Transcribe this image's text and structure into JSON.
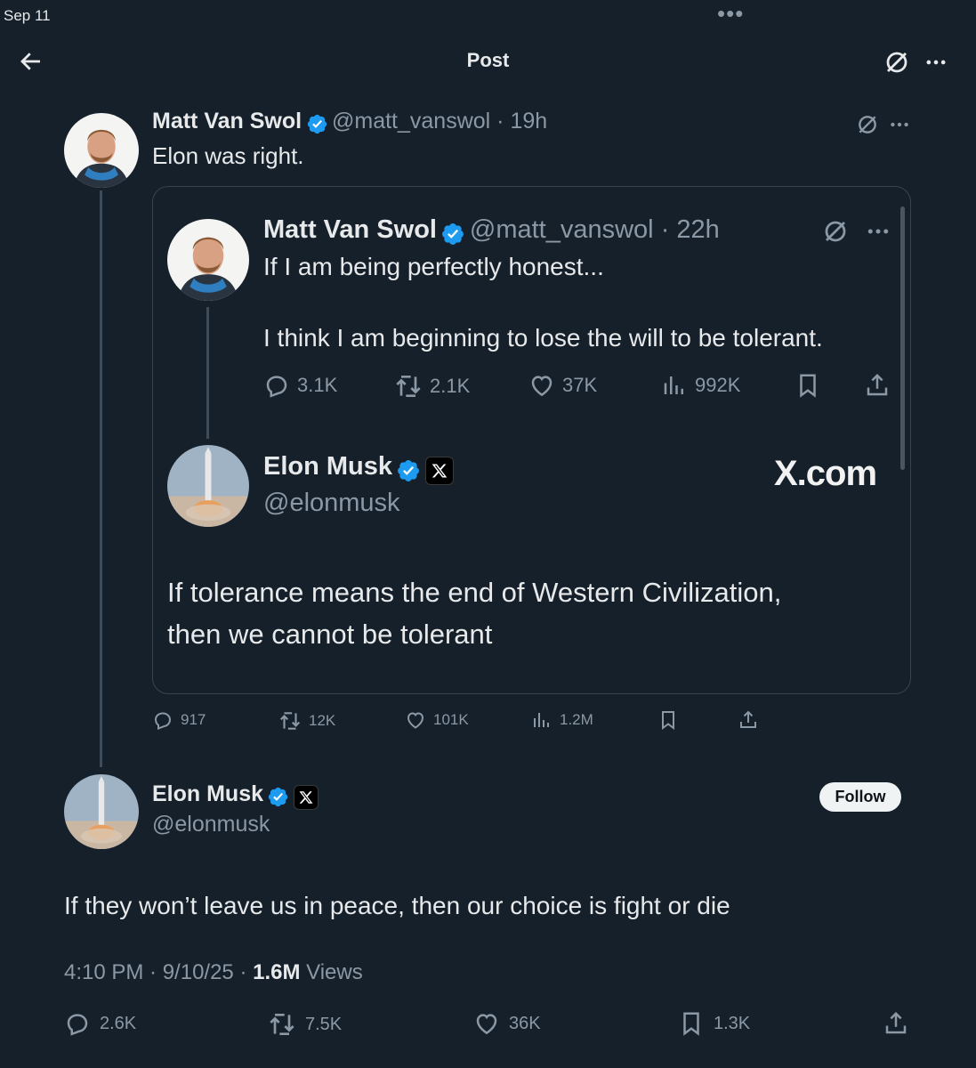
{
  "status": {
    "date": "Sep 11"
  },
  "header": {
    "title": "Post"
  },
  "main_post": {
    "name": "Matt Van Swol",
    "handle": "@matt_vanswol",
    "time": "19h",
    "text": "Elon was right.",
    "quote": {
      "tweet": {
        "name": "Matt Van Swol",
        "handle": "@matt_vanswol",
        "time": "22h",
        "line1": "If I am being perfectly honest...",
        "line2": "I think I am beginning to lose the will to be tolerant.",
        "replies": "3.1K",
        "reposts": "2.1K",
        "likes": "37K",
        "views": "992K"
      },
      "reply": {
        "name": "Elon Musk",
        "handle": "@elonmusk",
        "watermark": "X.com",
        "line1": "If tolerance means the end of Western Civilization,",
        "line2": "then we cannot be tolerant"
      }
    },
    "stats": {
      "replies": "917",
      "reposts": "12K",
      "likes": "101K",
      "views": "1.2M"
    }
  },
  "focus_post": {
    "name": "Elon Musk",
    "handle": "@elonmusk",
    "follow_label": "Follow",
    "text": "If they won’t leave us in peace, then our choice is fight or die",
    "timestamp": "4:10 PM · 9/10/25 · ",
    "views_count": "1.6M",
    "views_label": " Views",
    "stats": {
      "replies": "2.6K",
      "reposts": "7.5K",
      "likes": "36K",
      "bookmarks": "1.3K"
    }
  },
  "colors": {
    "background": "#15202b",
    "verified": "#1d9bf0",
    "muted": "#8b98a5",
    "text": "#e7e9ea"
  }
}
